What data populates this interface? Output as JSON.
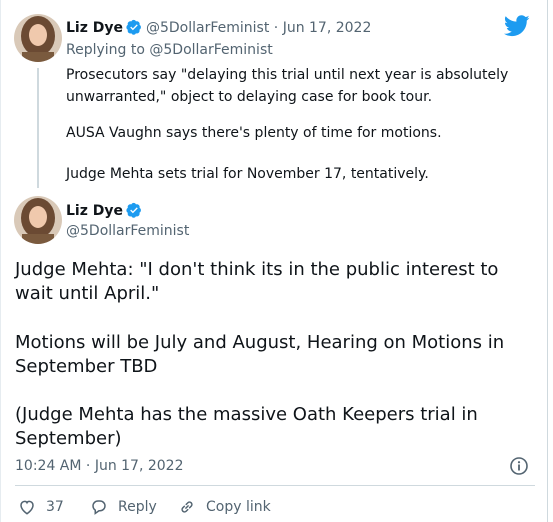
{
  "reply_tweet": {
    "display_name": "Liz Dye",
    "handle": "@5DollarFeminist",
    "date": "Jun 17, 2022",
    "replying_to_label": "Replying to",
    "replying_to_handle": "@5DollarFeminist",
    "paragraphs": [
      "Prosecutors say \"delaying this trial until next year is absolutely unwarranted,\" object to delaying case for book tour.",
      "AUSA Vaughn says there's plenty of time for motions.",
      "Judge Mehta sets trial for November 17, tentatively."
    ]
  },
  "main_tweet": {
    "display_name": "Liz Dye",
    "handle": "@5DollarFeminist",
    "paragraphs": [
      "Judge Mehta: \"I don't think its in the public interest to wait until April.\"",
      "Motions will be July and August, Hearing on Motions in September TBD",
      "(Judge Mehta has the massive Oath Keepers trial in September)"
    ],
    "time": "10:24 AM",
    "date": "Jun 17, 2022",
    "like_count": "37",
    "reply_label": "Reply",
    "copy_link_label": "Copy link"
  },
  "colors": {
    "brand": "#1d9bf0",
    "muted": "#536471",
    "text": "#0f1419"
  },
  "icons": [
    "twitter-bird-icon",
    "verified-badge-icon",
    "info-icon",
    "heart-icon",
    "reply-icon",
    "link-icon"
  ]
}
